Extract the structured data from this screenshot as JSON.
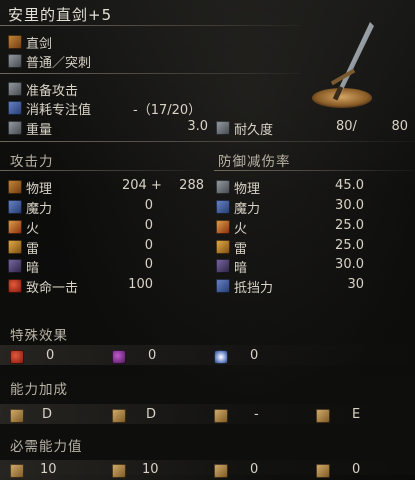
{
  "title": "安里的直剑+5",
  "weapon_info": {
    "type": "直剑",
    "attack_type": "普通／突刺",
    "skill_label": "准备攻击",
    "fp_label": "消耗专注值",
    "fp_value": "-（17/20）",
    "weight_label": "重量",
    "weight_value": "3.0",
    "durability_label": "耐久度",
    "durability_current": "80/",
    "durability_max": "80"
  },
  "attack": {
    "header": "攻击力",
    "rows": [
      {
        "label": "物理",
        "value": "204 +",
        "bonus": "288",
        "icon": "physical-icon"
      },
      {
        "label": "魔力",
        "value": "0",
        "icon": "magic-icon"
      },
      {
        "label": "火",
        "value": "0",
        "icon": "fire-icon"
      },
      {
        "label": "雷",
        "value": "0",
        "icon": "lightning-icon"
      },
      {
        "label": "暗",
        "value": "0",
        "icon": "dark-icon"
      },
      {
        "label": "致命一击",
        "value": "100",
        "icon": "critical-icon"
      }
    ]
  },
  "defense": {
    "header": "防御减伤率",
    "rows": [
      {
        "label": "物理",
        "value": "45.0",
        "icon": "physical-guard-icon"
      },
      {
        "label": "魔力",
        "value": "30.0",
        "icon": "magic-guard-icon"
      },
      {
        "label": "火",
        "value": "25.0",
        "icon": "fire-guard-icon"
      },
      {
        "label": "雷",
        "value": "25.0",
        "icon": "lightning-guard-icon"
      },
      {
        "label": "暗",
        "value": "30.0",
        "icon": "dark-guard-icon"
      },
      {
        "label": "抵挡力",
        "value": "30",
        "icon": "stability-icon"
      }
    ]
  },
  "special_effects": {
    "header": "特殊效果",
    "items": [
      {
        "value": "0",
        "icon": "bleed-icon"
      },
      {
        "value": "0",
        "icon": "poison-icon"
      },
      {
        "value": "0",
        "icon": "frost-icon"
      }
    ]
  },
  "scaling": {
    "header": "能力加成",
    "items": [
      {
        "value": "D",
        "icon": "strength-scaling-icon"
      },
      {
        "value": "D",
        "icon": "dexterity-scaling-icon"
      },
      {
        "value": "-",
        "icon": "intelligence-scaling-icon"
      },
      {
        "value": "E",
        "icon": "faith-scaling-icon"
      }
    ]
  },
  "requirements": {
    "header": "必需能力值",
    "items": [
      {
        "value": "10",
        "icon": "strength-req-icon"
      },
      {
        "value": "10",
        "icon": "dexterity-req-icon"
      },
      {
        "value": "0",
        "icon": "intelligence-req-icon"
      },
      {
        "value": "0",
        "icon": "faith-req-icon"
      }
    ]
  }
}
